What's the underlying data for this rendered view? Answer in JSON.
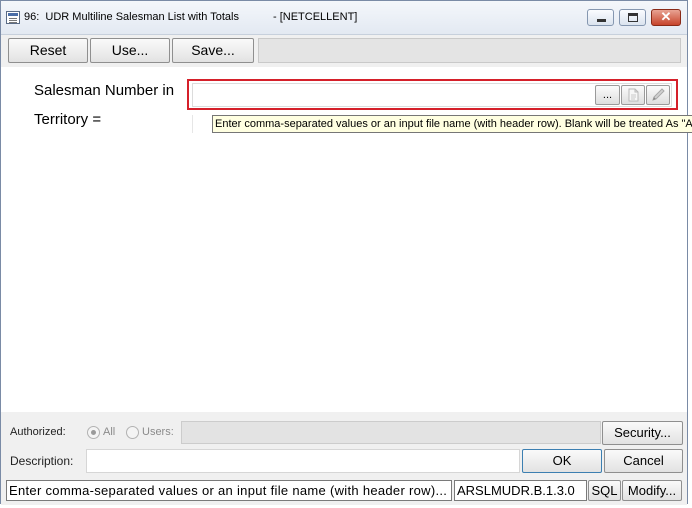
{
  "window": {
    "title": "96:  UDR Multiline Salesman List with Totals",
    "subtitle": "- [NETCELLENT]",
    "close_glyph": "✕"
  },
  "toolbar": {
    "reset_label": "Reset",
    "use_label": "Use...",
    "save_label": "Save..."
  },
  "form": {
    "salesman_label": "Salesman Number in",
    "territory_label": "Territory =",
    "salesman_value": "",
    "browse_label": "...",
    "tooltip": "Enter comma-separated values or an input file name (with header row).  Blank will be treated As \"All\""
  },
  "footer": {
    "authorized_label": "Authorized:",
    "all_label": "All",
    "users_label": "Users:",
    "security_label": "Security...",
    "description_label": "Description:",
    "description_value": "",
    "ok_label": "OK",
    "cancel_label": "Cancel",
    "status_text": "Enter comma-separated values or an input file name (with header row)...",
    "program_id": "ARSLMUDR.B.1.3.0",
    "sql_label": "SQL",
    "modify_label": "Modify..."
  },
  "colors": {
    "highlight_border": "#d5202a",
    "tooltip_bg": "#ffffe1"
  },
  "icons": [
    "app-icon",
    "minimize-icon",
    "maximize-icon",
    "close-icon",
    "browse-icon",
    "document-icon",
    "pencil-icon"
  ]
}
